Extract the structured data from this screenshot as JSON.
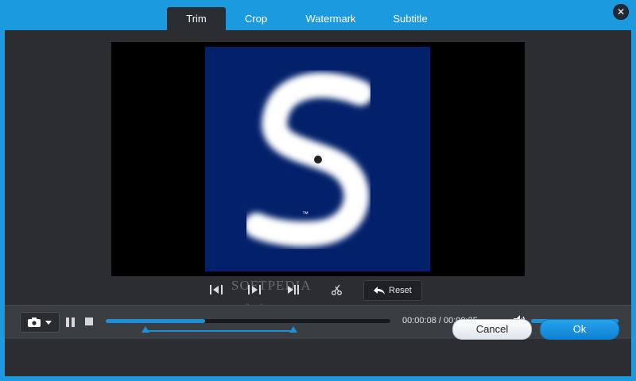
{
  "tabs": [
    {
      "label": "Trim",
      "active": true
    },
    {
      "label": "Crop",
      "active": false
    },
    {
      "label": "Watermark",
      "active": false
    },
    {
      "label": "Subtitle",
      "active": false
    }
  ],
  "close_icon": "close-icon",
  "video": {
    "frame_color": "#03216b",
    "letter": "S",
    "trademark": "™"
  },
  "controls": {
    "prev_frame_icon": "step-back-icon",
    "play_frame_icon": "step-play-icon",
    "next_frame_icon": "step-forward-icon",
    "cut_icon": "scissors-icon",
    "reset_label": "Reset"
  },
  "watermark": {
    "overlay_text": "SOFTPEDIA",
    "url_text": "www.softpedia.com"
  },
  "playback": {
    "snapshot_icon": "camera-icon",
    "pause_icon": "pause-icon",
    "stop_icon": "stop-icon",
    "current_time": "00:00:08",
    "total_time": "00:00:25",
    "time_display": "00:00:08 / 00:00:25",
    "progress": 0.35,
    "trim_start": 0.14,
    "trim_end": 0.66,
    "volume_icon": "volume-icon",
    "volume": 1.0
  },
  "footer": {
    "cancel_label": "Cancel",
    "ok_label": "Ok"
  },
  "colors": {
    "accent": "#1e90da",
    "titlebar": "#1b9ae0",
    "panel": "#2b2d31"
  }
}
